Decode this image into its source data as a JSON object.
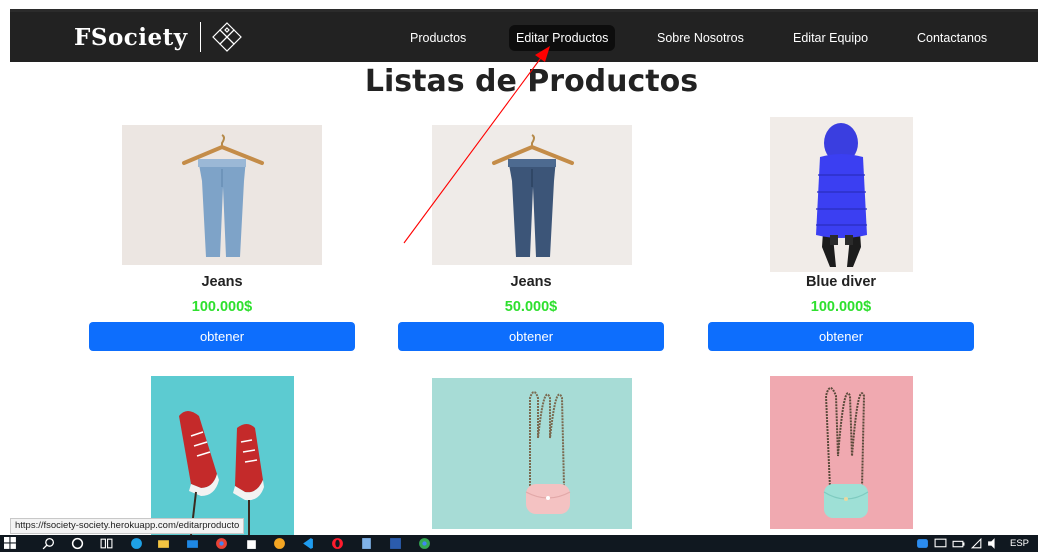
{
  "navbar": {
    "brand": "FSociety",
    "links": [
      {
        "label": "Productos"
      },
      {
        "label": "Editar Productos"
      },
      {
        "label": "Sobre Nosotros"
      },
      {
        "label": "Editar Equipo"
      },
      {
        "label": "Contactanos"
      }
    ]
  },
  "page": {
    "title": "Listas de Productos"
  },
  "products": [
    {
      "name": "Jeans",
      "price": "100.000$",
      "button": "obtener"
    },
    {
      "name": "Jeans",
      "price": "50.000$",
      "button": "obtener"
    },
    {
      "name": "Blue diver",
      "price": "100.000$",
      "button": "obtener"
    }
  ],
  "status_bar": {
    "url": "https://fsociety-society.herokuapp.com/editarproducto"
  },
  "taskbar": {
    "language": "ESP"
  },
  "colors": {
    "navbar_bg": "#222222",
    "button_bg": "#0d6efd",
    "price": "#2ee02e",
    "annotation_arrow": "#ff0000"
  }
}
